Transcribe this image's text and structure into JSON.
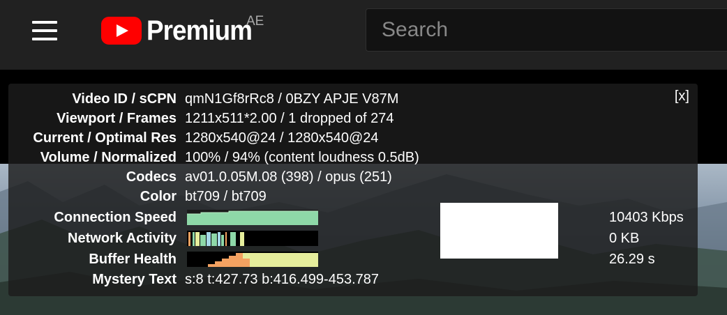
{
  "header": {
    "logo_text": "Premium",
    "region": "AE",
    "search_placeholder": "Search"
  },
  "stats": {
    "close_label": "[x]",
    "rows": [
      {
        "label": "Video ID / sCPN",
        "value": "qmN1Gf8rRc8 / 0BZY APJE V87M"
      },
      {
        "label": "Viewport / Frames",
        "value": "1211x511*2.00 / 1 dropped of 274"
      },
      {
        "label": "Current / Optimal Res",
        "value": "1280x540@24 / 1280x540@24"
      },
      {
        "label": "Volume / Normalized",
        "value": "100% / 94% (content loudness 0.5dB)"
      },
      {
        "label": "Codecs",
        "value": "av01.0.05M.08 (398) / opus (251)"
      },
      {
        "label": "Color",
        "value": "bt709 / bt709"
      },
      {
        "label": "Connection Speed",
        "value": ""
      },
      {
        "label": "Network Activity",
        "value": ""
      },
      {
        "label": "Buffer Health",
        "value": ""
      },
      {
        "label": "Mystery Text",
        "value": "s:8 t:427.73 b:416.499-453.787"
      }
    ],
    "connection_speed": "10403 Kbps",
    "network_activity": "0 KB",
    "buffer_health": "26.29 s"
  },
  "colors": {
    "brand_red": "#ff0000",
    "conn_graph": "#8ed8a8",
    "buffer_graph_a": "#f4a261",
    "buffer_graph_b": "#e6ee9c"
  }
}
